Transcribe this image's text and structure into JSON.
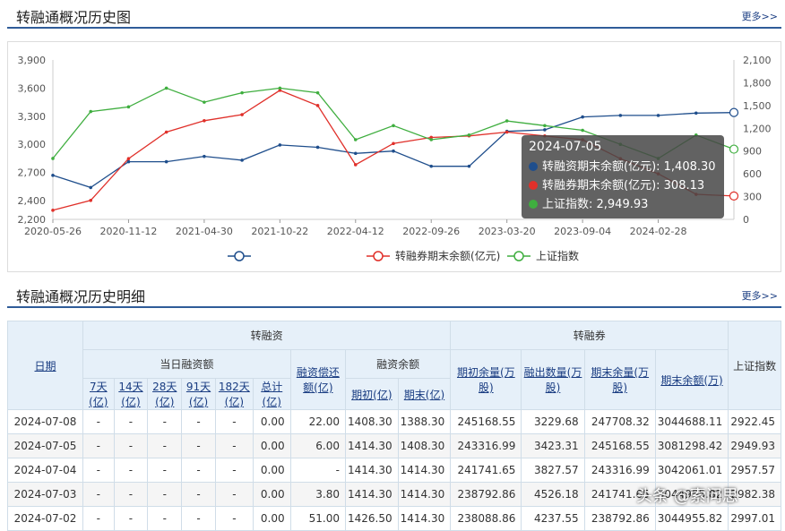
{
  "overview": {
    "title": "转融通概况历史图",
    "more": "更多>>"
  },
  "detail": {
    "title": "转融通概况历史明细",
    "more": "更多>>"
  },
  "watermark": "头条 @索问思",
  "colors": {
    "financing": "#1f4e8c",
    "securities": "#e0302a",
    "index": "#3fae3f"
  },
  "tooltip": {
    "date": "2024-07-05",
    "rows": [
      {
        "color": "#1f4e8c",
        "text": "转融资期末余额(亿元): 1,408.30"
      },
      {
        "color": "#e0302a",
        "text": "转融券期末余额(亿元): 308.13"
      },
      {
        "color": "#3fae3f",
        "text": "上证指数: 2,949.93"
      }
    ]
  },
  "legend": [
    "",
    "转融券期末余额(亿元)",
    "上证指数"
  ],
  "chart_data": {
    "type": "line",
    "x": [
      "2020-05-26",
      "2020-08-19",
      "2020-11-12",
      "2021-02-05",
      "2021-04-30",
      "2021-07-25",
      "2021-10-22",
      "2022-01-15",
      "2022-04-12",
      "2022-07-06",
      "2022-09-26",
      "2022-12-22",
      "2023-03-20",
      "2023-06-12",
      "2023-09-04",
      "2023-11-29",
      "2024-02-28",
      "2024-05-20",
      "2024-07-08"
    ],
    "xticks": [
      "2020-05-26",
      "2020-11-12",
      "2021-04-30",
      "2021-10-22",
      "2022-04-12",
      "2022-09-26",
      "2023-03-20",
      "2023-09-04",
      "2024-02-28"
    ],
    "y_left_ticks": [
      "3,900",
      "3,600",
      "3,300",
      "3,000",
      "2,700",
      "2,400",
      "2,200"
    ],
    "y_right_ticks": [
      "2,100",
      "1,800",
      "1,500",
      "1,200",
      "900",
      "600",
      "300",
      "0"
    ],
    "ylim_left": [
      2200,
      3900
    ],
    "ylim_right": [
      0,
      2100
    ],
    "series": [
      {
        "name": "转融资期末余额(亿元)",
        "axis": "right",
        "values": [
          580,
          420,
          760,
          760,
          830,
          780,
          980,
          950,
          870,
          900,
          700,
          700,
          1160,
          1180,
          1350,
          1370,
          1370,
          1400,
          1408
        ]
      },
      {
        "name": "转融券期末余额(亿元)",
        "axis": "right",
        "values": [
          120,
          250,
          800,
          1150,
          1300,
          1380,
          1700,
          1500,
          720,
          1000,
          1080,
          1100,
          1150,
          1100,
          1050,
          800,
          600,
          330,
          308
        ]
      },
      {
        "name": "上证指数",
        "axis": "left",
        "values": [
          2850,
          3350,
          3400,
          3600,
          3450,
          3550,
          3600,
          3550,
          3050,
          3200,
          3050,
          3100,
          3250,
          3200,
          3150,
          3000,
          2850,
          3100,
          2949
        ]
      }
    ]
  },
  "table": {
    "date_header": "日期",
    "financing_header": "转融资",
    "securities_header": "转融券",
    "index_header": "上证指数",
    "daily_header": "当日融资额",
    "balance_header": "融资余额",
    "terms": [
      "7天(亿)",
      "14天(亿)",
      "28天(亿)",
      "91天(亿)",
      "182天(亿)",
      "总计(亿)"
    ],
    "repay": "融资偿还额(亿)",
    "open": "期初(亿)",
    "close": "期末(亿)",
    "sec_cols": [
      "期初余量(万股)",
      "融出数量(万股)",
      "期末余量(万股)",
      "期末余额(万)"
    ],
    "rows": [
      [
        "2024-07-08",
        "-",
        "-",
        "-",
        "-",
        "-",
        "0.00",
        "22.00",
        "1408.30",
        "1388.30",
        "245168.55",
        "3229.68",
        "247708.32",
        "3044688.11",
        "2922.45"
      ],
      [
        "2024-07-05",
        "-",
        "-",
        "-",
        "-",
        "-",
        "0.00",
        "6.00",
        "1414.30",
        "1408.30",
        "243316.99",
        "3423.31",
        "245168.55",
        "3081298.42",
        "2949.93"
      ],
      [
        "2024-07-04",
        "-",
        "-",
        "-",
        "-",
        "-",
        "0.00",
        "-",
        "1414.30",
        "1414.30",
        "241741.65",
        "3827.57",
        "243316.99",
        "3042061.01",
        "2957.57"
      ],
      [
        "2024-07-03",
        "-",
        "-",
        "-",
        "-",
        "-",
        "0.00",
        "3.80",
        "1414.30",
        "1414.30",
        "238792.86",
        "4526.18",
        "241741.65",
        "3044955.82",
        "2982.38"
      ],
      [
        "2024-07-02",
        "-",
        "-",
        "-",
        "-",
        "-",
        "0.00",
        "51.00",
        "1426.50",
        "1414.30",
        "238088.86",
        "4237.55",
        "238792.86",
        "3044955.82",
        "2997.01"
      ]
    ]
  }
}
